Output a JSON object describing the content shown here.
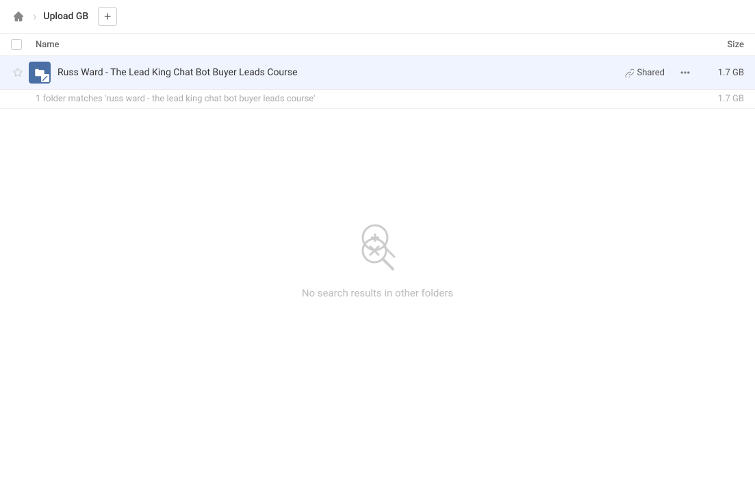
{
  "toolbar": {
    "title": "Upload GB",
    "add_button_label": "+",
    "home_icon": "home-icon"
  },
  "table": {
    "col_name_label": "Name",
    "col_size_label": "Size"
  },
  "file_row": {
    "name": "Russ Ward - The Lead King Chat Bot Buyer Leads Course",
    "shared_label": "Shared",
    "size": "1.7 GB",
    "more_icon": "more-icon"
  },
  "status": {
    "text": "1 folder matches 'russ ward - the lead king chat bot buyer leads course'",
    "size": "1.7 GB"
  },
  "empty_state": {
    "text": "No search results in other folders"
  }
}
